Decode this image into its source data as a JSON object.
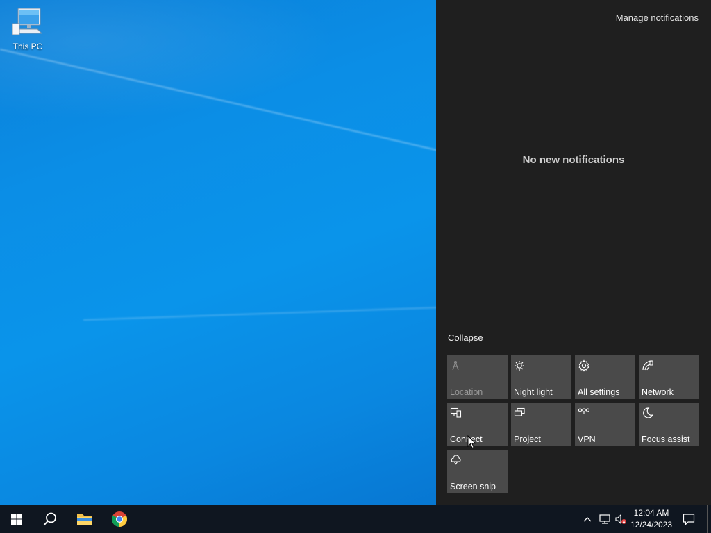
{
  "desktop": {
    "icons": [
      {
        "label": "This PC",
        "icon": "computer-icon"
      }
    ]
  },
  "action_center": {
    "manage_label": "Manage notifications",
    "empty_message": "No new notifications",
    "collapse_label": "Collapse",
    "quick_actions": [
      {
        "label": "Location",
        "icon": "location-icon",
        "enabled": false
      },
      {
        "label": "Night light",
        "icon": "brightness-icon",
        "enabled": true
      },
      {
        "label": "All settings",
        "icon": "gear-icon",
        "enabled": true
      },
      {
        "label": "Network",
        "icon": "network-icon",
        "enabled": true
      },
      {
        "label": "Connect",
        "icon": "connect-icon",
        "enabled": true
      },
      {
        "label": "Project",
        "icon": "project-icon",
        "enabled": true
      },
      {
        "label": "VPN",
        "icon": "vpn-icon",
        "enabled": true
      },
      {
        "label": "Focus assist",
        "icon": "moon-icon",
        "enabled": true
      },
      {
        "label": "Screen snip",
        "icon": "snip-icon",
        "enabled": true
      }
    ]
  },
  "taskbar": {
    "pinned": [
      {
        "name": "Start",
        "icon": "windows-logo-icon"
      },
      {
        "name": "Search",
        "icon": "search-icon"
      },
      {
        "name": "File Explorer",
        "icon": "folder-icon"
      },
      {
        "name": "Google Chrome",
        "icon": "chrome-icon"
      }
    ],
    "tray": {
      "icons": [
        "chevron-up-icon",
        "network-tray-icon",
        "volume-muted-icon"
      ],
      "time": "12:04 AM",
      "date": "12/24/2023",
      "notification_icon": "action-center-icon"
    }
  },
  "colors": {
    "panel_bg": "#1f1f1f",
    "tile_bg": "#4a4a4a",
    "taskbar_bg": "#0f1620",
    "desktop_blue": "#0a8fe6"
  }
}
